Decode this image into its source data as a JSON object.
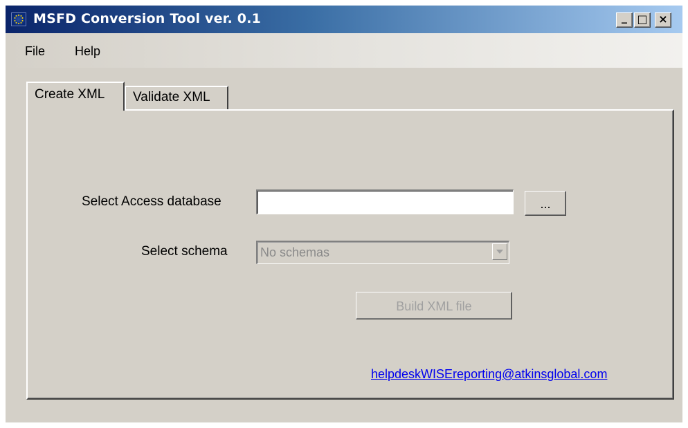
{
  "window": {
    "title": "MSFD Conversion Tool ver. 0.1",
    "app_icon": "eu-flag-icon",
    "controls": {
      "minimize": "_",
      "maximize": "□",
      "close": "×"
    }
  },
  "menu": {
    "items": [
      {
        "label": "File"
      },
      {
        "label": "Help"
      }
    ]
  },
  "tabs": [
    {
      "label": "Create XML",
      "active": true
    },
    {
      "label": "Validate XML",
      "active": false
    }
  ],
  "form": {
    "database_label": "Select Access database",
    "database_value": "",
    "browse_label": "...",
    "schema_label": "Select schema",
    "schema_value": "No schemas",
    "build_label": "Build XML file"
  },
  "footer": {
    "email": "helpdeskWISEreporting@atkinsglobal.com"
  },
  "colors": {
    "titlebar_start": "#0a246a",
    "titlebar_end": "#a6caf0",
    "window_bg": "#d4d0c8",
    "link": "#0000ee"
  }
}
